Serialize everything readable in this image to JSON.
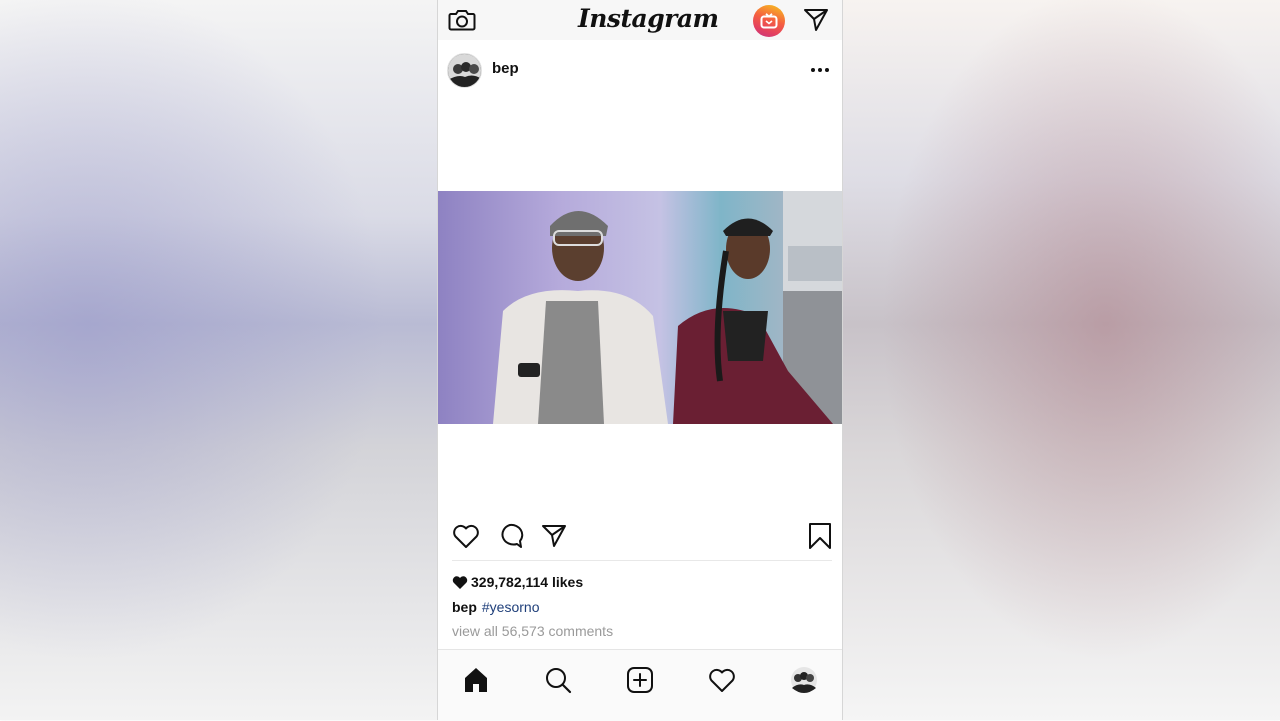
{
  "app": {
    "logo_text": "Instagram"
  },
  "topbar": {
    "camera_icon": "camera-icon",
    "igtv_icon": "igtv-icon",
    "direct_icon": "paper-plane-icon",
    "igtv_gradient": [
      "#f6b024",
      "#f56040",
      "#e4405f",
      "#c13584"
    ]
  },
  "post": {
    "username": "bep",
    "more_icon": "more-horizontal-icon",
    "actions": {
      "like_icon": "heart-outline-icon",
      "comment_icon": "comment-icon",
      "share_icon": "paper-plane-icon",
      "save_icon": "bookmark-icon"
    },
    "likes_text": "329,782,114 likes",
    "caption_user": "bep",
    "caption_hashtag": "#yesorno",
    "comments_link": "view all 56,573 comments",
    "colors": {
      "hashtag": "#1f3f7a",
      "muted": "#9a9a9a"
    }
  },
  "bottom_nav": {
    "items": [
      "home-icon",
      "search-icon",
      "add-post-icon",
      "activity-heart-icon",
      "profile-avatar"
    ]
  }
}
